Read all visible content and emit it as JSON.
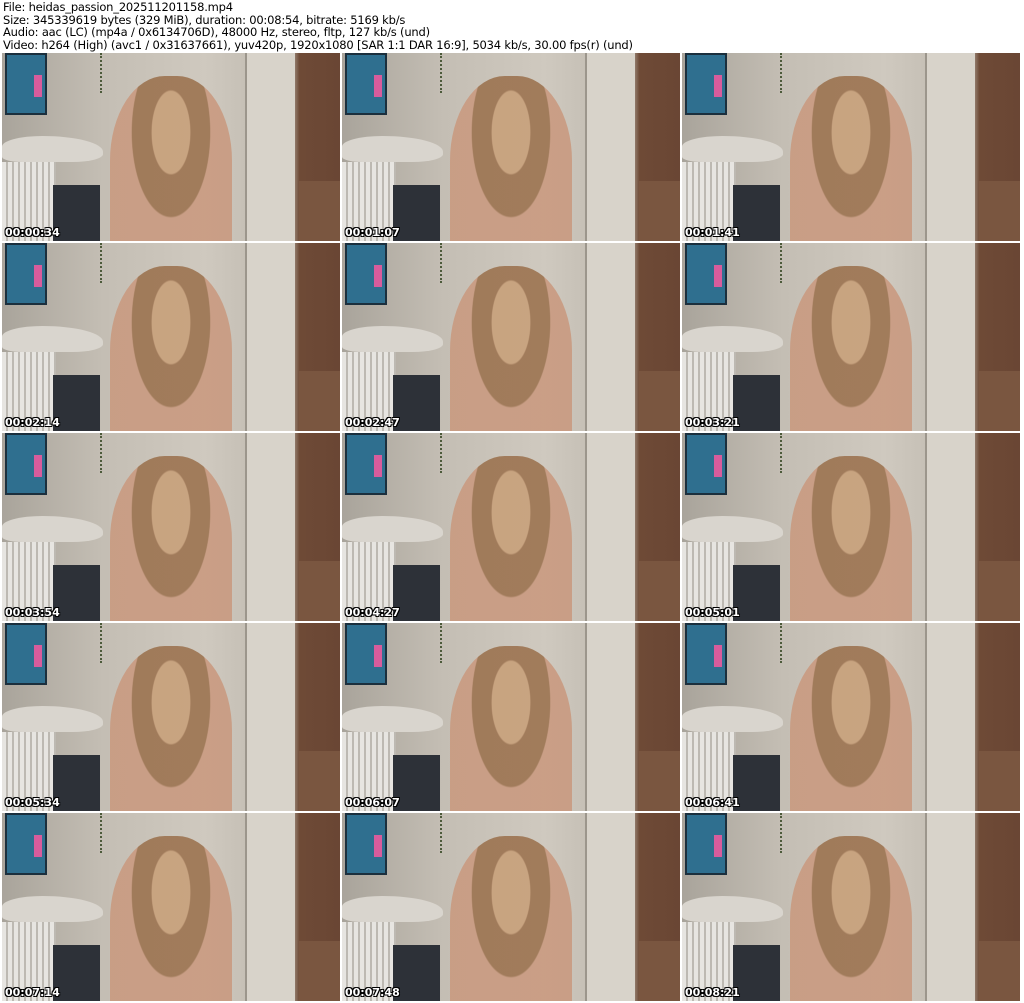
{
  "header": {
    "file": "File: heidas_passion_202511201158.mp4",
    "size": "Size: 345339619 bytes (329 MiB), duration: 00:08:54, bitrate: 5169 kb/s",
    "audio": "Audio: aac (LC) (mp4a / 0x6134706D), 48000 Hz, stereo, fltp, 127 kb/s (und)",
    "video": "Video: h264 (High) (avc1 / 0x31637661), yuv420p, 1920x1080 [SAR 1:1 DAR 16:9], 5034 kb/s, 30.00 fps(r) (und)"
  },
  "thumbnails": [
    {
      "timestamp": "00:00:34"
    },
    {
      "timestamp": "00:01:07"
    },
    {
      "timestamp": "00:01:41"
    },
    {
      "timestamp": "00:02:14"
    },
    {
      "timestamp": "00:02:47"
    },
    {
      "timestamp": "00:03:21"
    },
    {
      "timestamp": "00:03:54"
    },
    {
      "timestamp": "00:04:27"
    },
    {
      "timestamp": "00:05:01"
    },
    {
      "timestamp": "00:05:34"
    },
    {
      "timestamp": "00:06:07"
    },
    {
      "timestamp": "00:06:41"
    },
    {
      "timestamp": "00:07:14"
    },
    {
      "timestamp": "00:07:48"
    },
    {
      "timestamp": "00:08:21"
    }
  ]
}
